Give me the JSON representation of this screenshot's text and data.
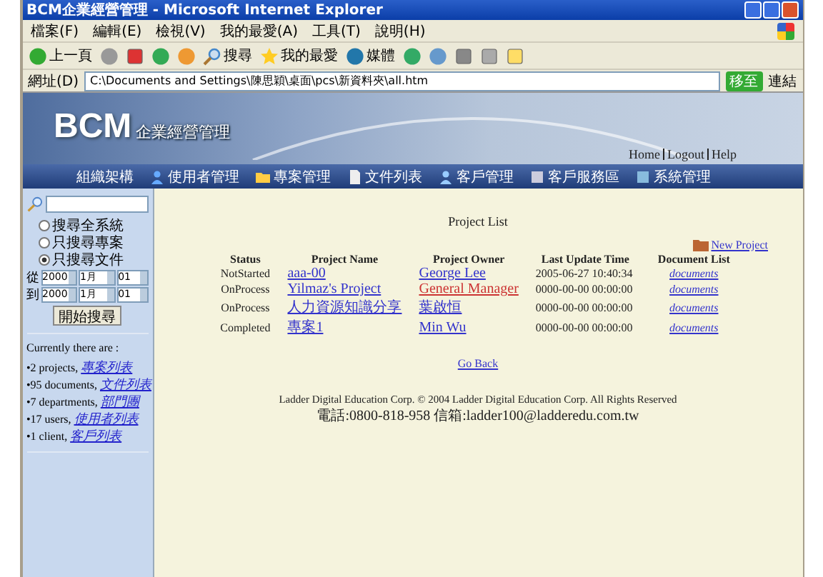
{
  "window": {
    "title": "BCM企業經營管理 - Microsoft Internet Explorer"
  },
  "menu": [
    "檔案(F)",
    "編輯(E)",
    "檢視(V)",
    "我的最愛(A)",
    "工具(T)",
    "說明(H)"
  ],
  "toolbar": [
    {
      "kind": "back",
      "label": "上一頁"
    },
    {
      "kind": "forward"
    },
    {
      "kind": "stop"
    },
    {
      "kind": "refresh"
    },
    {
      "kind": "home"
    },
    {
      "kind": "search",
      "label": "搜尋"
    },
    {
      "kind": "favorites",
      "label": "我的最愛"
    },
    {
      "kind": "media",
      "label": "媒體"
    },
    {
      "kind": "history"
    },
    {
      "kind": "mail"
    },
    {
      "kind": "print"
    },
    {
      "kind": "edit"
    },
    {
      "kind": "folder"
    }
  ],
  "address": {
    "label": "網址(D)",
    "value": "C:\\Documents and Settings\\陳思穎\\桌面\\pcs\\新資料夾\\all.htm",
    "go": "移至",
    "links": "連結"
  },
  "banner": {
    "logo": "BCM",
    "logo_sub": "企業經營管理",
    "links": [
      "Home",
      "Logout",
      "Help"
    ]
  },
  "nav": [
    {
      "kind": "org",
      "label": "組織架構"
    },
    {
      "kind": "users",
      "label": "使用者管理"
    },
    {
      "kind": "project",
      "label": "專案管理"
    },
    {
      "kind": "doc",
      "label": "文件列表"
    },
    {
      "kind": "client",
      "label": "客戶管理"
    },
    {
      "kind": "service",
      "label": "客戶服務區"
    },
    {
      "kind": "system",
      "label": "系統管理"
    }
  ],
  "sidebar": {
    "scopes": [
      {
        "label": "搜尋全系統",
        "selected": false
      },
      {
        "label": "只搜尋專案",
        "selected": false
      },
      {
        "label": "只搜尋文件",
        "selected": true
      }
    ],
    "ranges": [
      {
        "label": "從",
        "year": "2000",
        "month": "1月",
        "day": "01"
      },
      {
        "label": "到",
        "year": "2000",
        "month": "1月",
        "day": "01"
      }
    ],
    "search_button": "開始搜尋",
    "summary_title": "Currently there are :",
    "summary": [
      {
        "count": "•2 projects,",
        "link": "專案列表"
      },
      {
        "count": "•95 documents,",
        "link": "文件列表"
      },
      {
        "count": "•7 departments,",
        "link": "部門團"
      },
      {
        "count": "•17 users,",
        "link": "使用者列表"
      },
      {
        "count": "•1 client,",
        "link": "客戶列表"
      }
    ]
  },
  "main": {
    "title": "Project List",
    "new_project": "New Project",
    "columns": [
      "Status",
      "Project Name",
      "Project Owner",
      "Last Update Time",
      "Document List"
    ],
    "rows": [
      {
        "status": "NotStarted",
        "name": "aaa-00",
        "owner": "George Lee",
        "owner_visited": false,
        "time": "2005-06-27 10:40:34",
        "docs": "documents"
      },
      {
        "status": "OnProcess",
        "name": "Yilmaz's Project",
        "owner": "General Manager",
        "owner_visited": true,
        "time": "0000-00-00 00:00:00",
        "docs": "documents"
      },
      {
        "status": "OnProcess",
        "name": "人力資源知識分享",
        "owner": "葉啟恒",
        "owner_visited": false,
        "time": "0000-00-00 00:00:00",
        "docs": "documents"
      },
      {
        "status": "Completed",
        "name": "專案1",
        "owner": "Min Wu",
        "owner_visited": false,
        "time": "0000-00-00 00:00:00",
        "docs": "documents"
      }
    ],
    "go_back": "Go Back",
    "footer": [
      "Ladder Digital Education Corp. © 2004 Ladder Digital Education Corp. All Rights Reserved",
      "電話:0800-818-958 信箱:ladder100@ladderedu.com.tw"
    ]
  }
}
